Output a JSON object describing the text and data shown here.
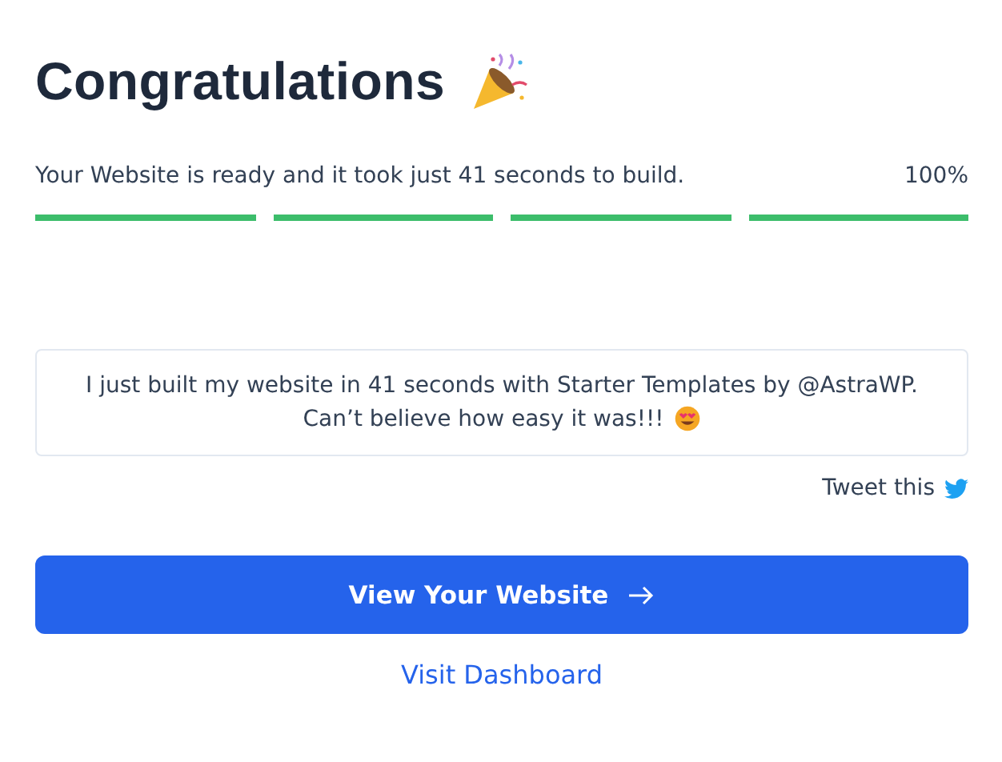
{
  "title": "Congratulations",
  "progress": {
    "message": "Your Website is ready and it took just 41 seconds to build.",
    "percent": "100%",
    "segments": [
      {
        "level": 1
      },
      {
        "level": 1
      },
      {
        "level": 1
      },
      {
        "level": 1
      }
    ]
  },
  "tweet": {
    "lines": [
      "I just built my website in 41 seconds with Starter Templates by @AstraWP.",
      "Can’t believe how easy it was!!!"
    ],
    "action": "Tweet this"
  },
  "primary_button": "View Your Website",
  "link": "Visit Dashboard"
}
